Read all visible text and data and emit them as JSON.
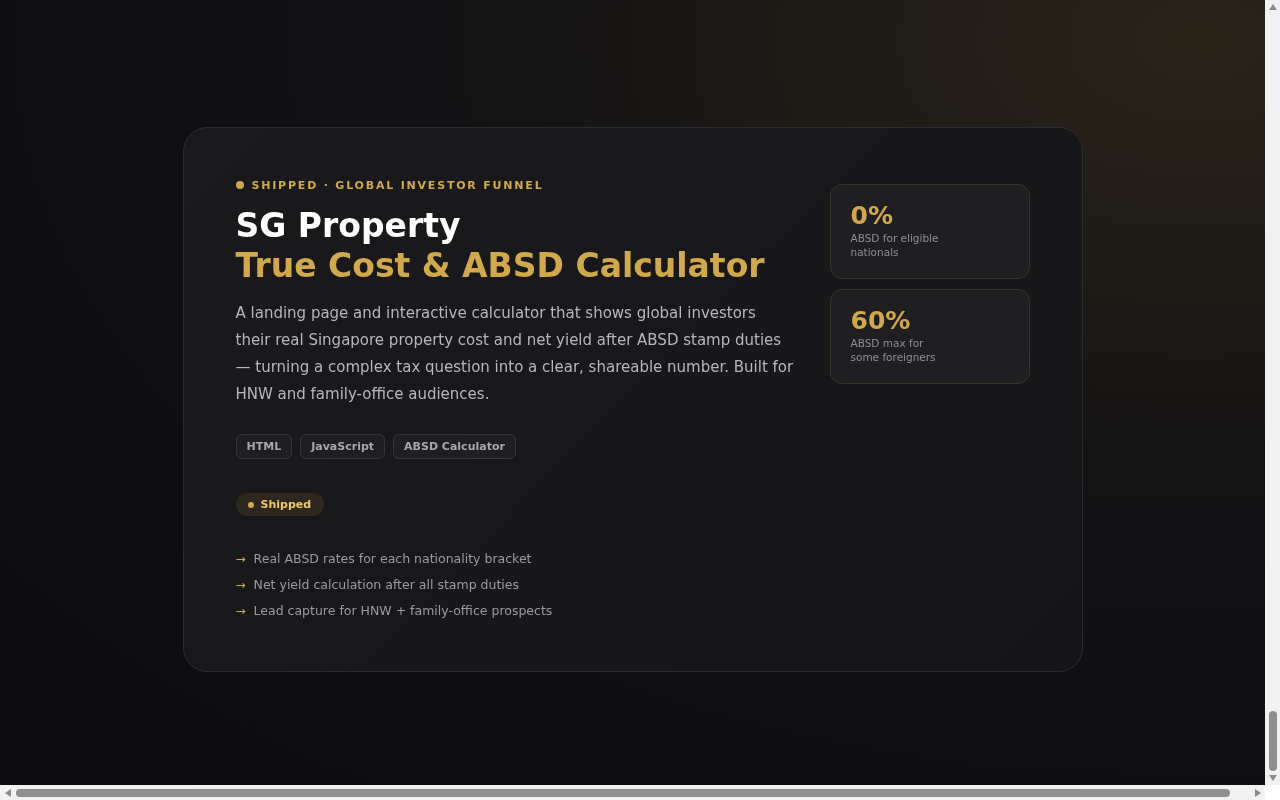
{
  "card": {
    "eyebrow": "SHIPPED · GLOBAL INVESTOR FUNNEL",
    "title": "SG Property",
    "subtitle": "True Cost & ABSD Calculator",
    "description": "A landing page and interactive calculator that shows global investors their real Singapore property cost and net yield after ABSD stamp duties — turning a complex tax question into a clear, shareable number. Built for HNW and family-office audiences.",
    "tags": [
      "HTML",
      "JavaScript",
      "ABSD Calculator"
    ],
    "status": "Shipped",
    "features": [
      {
        "arrow": "→",
        "text": "Real ABSD rates for each nationality bracket"
      },
      {
        "arrow": "→",
        "text": "Net yield calculation after all stamp duties"
      },
      {
        "arrow": "→",
        "text": "Lead capture for HNW + family-office prospects"
      }
    ],
    "stats": [
      {
        "value": "0%",
        "label": "ABSD for eligible nationals"
      },
      {
        "value": "60%",
        "label": "ABSD max for some foreigners"
      }
    ]
  }
}
